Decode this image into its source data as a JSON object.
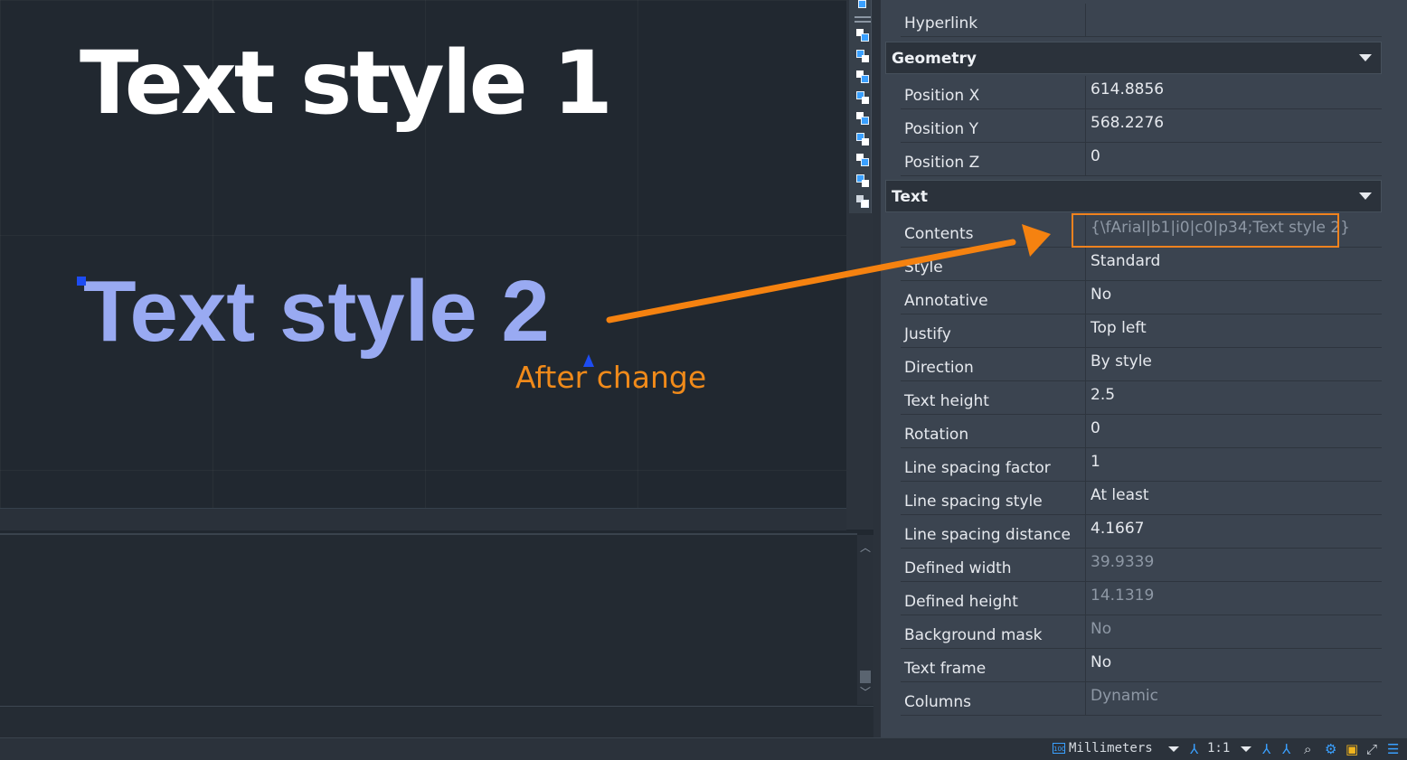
{
  "canvas": {
    "text1": "Text style 1",
    "text2": "Text style 2",
    "annotation": "After change"
  },
  "properties": {
    "top_row": {
      "label": "Hyperlink",
      "value": ""
    },
    "geometry": {
      "title": "Geometry",
      "rows": [
        {
          "label": "Position X",
          "value": "614.8856"
        },
        {
          "label": "Position Y",
          "value": "568.2276"
        },
        {
          "label": "Position Z",
          "value": "0"
        }
      ]
    },
    "text": {
      "title": "Text",
      "rows": [
        {
          "label": "Contents",
          "value": "{\\fArial|b1|i0|c0|p34;Text style 2}",
          "dim": true
        },
        {
          "label": "Style",
          "value": "Standard"
        },
        {
          "label": "Annotative",
          "value": "No"
        },
        {
          "label": "Justify",
          "value": "Top left"
        },
        {
          "label": "Direction",
          "value": "By style"
        },
        {
          "label": "Text height",
          "value": "2.5"
        },
        {
          "label": "Rotation",
          "value": "0"
        },
        {
          "label": "Line spacing factor",
          "value": "1"
        },
        {
          "label": "Line spacing style",
          "value": "At least"
        },
        {
          "label": "Line spacing distance",
          "value": "4.1667"
        },
        {
          "label": "Defined width",
          "value": "39.9339",
          "dim": true
        },
        {
          "label": "Defined height",
          "value": "14.1319",
          "dim": true
        },
        {
          "label": "Background mask",
          "value": "No",
          "dim": true
        },
        {
          "label": "Text frame",
          "value": "No"
        },
        {
          "label": "Columns",
          "value": "Dynamic",
          "dim": true
        }
      ]
    }
  },
  "statusbar": {
    "units_icon_text": "100",
    "units": "Millimeters",
    "scale": "1:1"
  },
  "colors": {
    "accent_orange": "#f08a1a",
    "text2_color": "#99aaf2",
    "grip_blue": "#1d4cf2"
  },
  "icons": {
    "toolbar": [
      "draw-order-icon",
      "bring-to-front-icon",
      "send-to-back-icon",
      "bring-above-icon",
      "send-under-icon",
      "text-above-icon",
      "hatch-back-icon",
      "dim-front-icon",
      "annot-front-icon",
      "layer-icon"
    ],
    "statusbar": [
      "units-icon",
      "annotation-scale-icon",
      "annotation-visibility-icon",
      "auto-scale-icon",
      "isolate-icon",
      "gear-icon",
      "hardware-accel-icon",
      "fullscreen-icon",
      "menu-icon"
    ]
  }
}
